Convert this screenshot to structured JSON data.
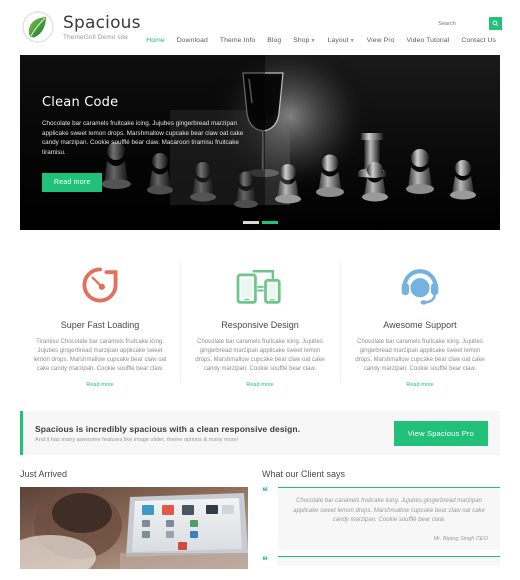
{
  "theme": {
    "accent": "#21c17a",
    "orange": "#e2705a",
    "green": "#6cc788",
    "blue": "#74b3e0",
    "panel_bg": "#f7f7f7",
    "page_bg": "#f5f5f5"
  },
  "header": {
    "site_title": "Spacious",
    "site_description": "ThemeGrill Demo site",
    "logo_icon": "leaf-logo-icon",
    "search": {
      "placeholder": "Search",
      "value": "",
      "button_icon": "search-icon"
    },
    "nav": [
      {
        "label": "Home",
        "active": true,
        "has_caret": false
      },
      {
        "label": "Download",
        "active": false,
        "has_caret": false
      },
      {
        "label": "Theme Info",
        "active": false,
        "has_caret": false
      },
      {
        "label": "Blog",
        "active": false,
        "has_caret": false
      },
      {
        "label": "Shop",
        "active": false,
        "has_caret": true
      },
      {
        "label": "Layout",
        "active": false,
        "has_caret": true
      },
      {
        "label": "View Pro",
        "active": false,
        "has_caret": false
      },
      {
        "label": "Video Tutorial",
        "active": false,
        "has_caret": false
      },
      {
        "label": "Contact Us",
        "active": false,
        "has_caret": false
      }
    ]
  },
  "slider": {
    "image_alt": "chess-pieces-and-wine-glass-photo",
    "title": "Clean Code",
    "text": "Chocolate bar caramels fruitcake icing. Jujubes gingerbread marzipan applicake sweet lemon drops. Marshmallow cupcake bear claw oat cake candy marzipan. Cookie soufflé bear claw. Macaroon tiramisu fruitcake tiramisu.",
    "button_label": "Read more",
    "dots": [
      {
        "active": false
      },
      {
        "active": true
      }
    ]
  },
  "features": [
    {
      "icon": "speedometer-icon",
      "color": "#e2705a",
      "title": "Super Fast Loading",
      "text": "Tiramisu Chocolate bar caramels fruitcake icing. Jujubes gingerbread marzipan applicake sweet lemon drops. Marshmallow cupcake bear claw oat cake candy marzipan. Cookie soufflé bear claw.",
      "link_label": "Read more"
    },
    {
      "icon": "responsive-devices-icon",
      "color": "#6cc788",
      "title": "Responsive Design",
      "text": "Chocolate bar caramels fruitcake icing. Jujubes gingerbread marzipan applicake sweet lemon drops. Marshmallow cupcake bear claw oat cake candy marzipan. Cookie soufflé bear claw.",
      "link_label": "Read more"
    },
    {
      "icon": "headset-support-icon",
      "color": "#74b3e0",
      "title": "Awesome Support",
      "text": "Chocolate bar caramels fruitcake icing. Jujubes gingerbread marzipan applicake sweet lemon drops. Marshmallow cupcake bear claw oat cake candy marzipan. Cookie soufflé bear claw.",
      "link_label": "Read more"
    }
  ],
  "cta": {
    "title": "Spacious is incredibly spacious with a clean responsive design.",
    "subtitle": "And it has many awesome features like image slider, theme options & many more!",
    "button_label": "View Spacious Pro"
  },
  "just_arrived": {
    "heading": "Just Arrived",
    "image_alt": "person-using-laptop-photo"
  },
  "testimonials": {
    "heading": "What our Client says",
    "quote_icon": "quote-mark-icon",
    "items": [
      {
        "text": "Chocolate bar caramels fruitcake icing. Jujubes gingerbread marzipan applicake sweet lemon drops. Marshmallow cupcake bear claw oat cake candy marzipan. Cookie soufflé bear claw.",
        "author": "Mr. Biping Singh CEO"
      }
    ]
  }
}
